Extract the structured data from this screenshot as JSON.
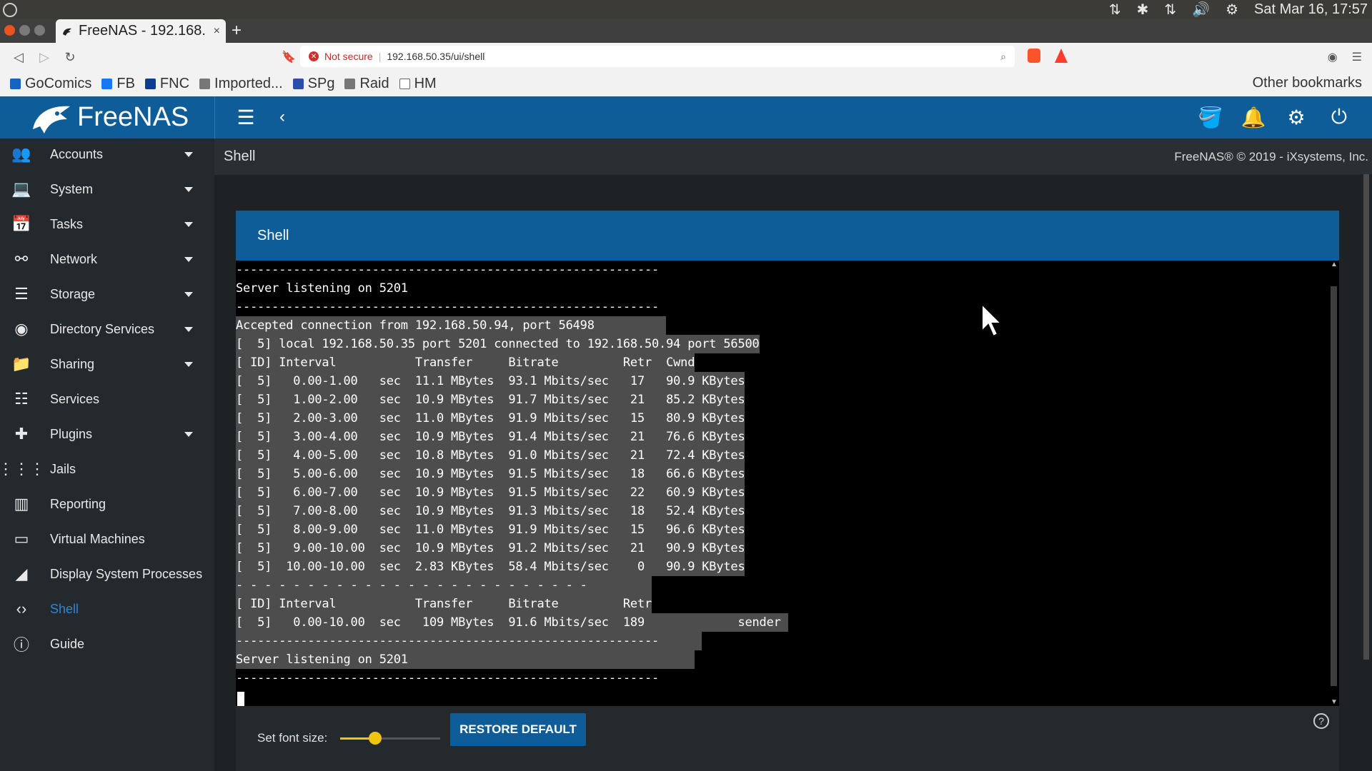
{
  "os": {
    "datetime": "Sat Mar 16, 17:57",
    "tray_icons": [
      "network-icon",
      "bluetooth-icon",
      "transfer-icon",
      "volume-icon",
      "settings-gear-icon"
    ]
  },
  "browser": {
    "tab_title": "FreeNAS - 192.168.",
    "tab_close": "×",
    "new_tab": "+",
    "security_label": "Not secure",
    "url": "192.168.50.35/ui/shell",
    "bookmarks": [
      {
        "label": "GoComics",
        "color": "#1565c0"
      },
      {
        "label": "FB",
        "color": "#1877f2"
      },
      {
        "label": "FNC",
        "color": "#0b3d91"
      },
      {
        "label": "Imported...",
        "color": "#777777"
      },
      {
        "label": "SPg",
        "color": "#2b4fa8"
      },
      {
        "label": "Raid",
        "color": "#777777"
      },
      {
        "label": "HM",
        "color": "#ffffff"
      }
    ],
    "other_bookmarks": "Other bookmarks"
  },
  "app": {
    "brand": "FreeNAS",
    "accent": "#0e5d98",
    "copyright": "FreeNAS® © 2019 - iXsystems, Inc.",
    "page_title": "Shell"
  },
  "sidebar": {
    "items": [
      {
        "label": "Accounts",
        "icon": "people-icon",
        "glyph": "👥",
        "caret": true
      },
      {
        "label": "System",
        "icon": "laptop-icon",
        "glyph": "💻",
        "caret": true
      },
      {
        "label": "Tasks",
        "icon": "calendar-icon",
        "glyph": "📅",
        "caret": true
      },
      {
        "label": "Network",
        "icon": "network-hub-icon",
        "glyph": "⚯",
        "caret": true
      },
      {
        "label": "Storage",
        "icon": "storage-icon",
        "glyph": "☰",
        "caret": true
      },
      {
        "label": "Directory Services",
        "icon": "directory-icon",
        "glyph": "◉",
        "caret": true
      },
      {
        "label": "Sharing",
        "icon": "folder-share-icon",
        "glyph": "📁",
        "caret": true
      },
      {
        "label": "Services",
        "icon": "sliders-icon",
        "glyph": "☷",
        "caret": false
      },
      {
        "label": "Plugins",
        "icon": "puzzle-icon",
        "glyph": "✚",
        "caret": true
      },
      {
        "label": "Jails",
        "icon": "grid-icon",
        "glyph": "⋮⋮⋮",
        "caret": false
      },
      {
        "label": "Reporting",
        "icon": "bar-chart-icon",
        "glyph": "▥",
        "caret": false
      },
      {
        "label": "Virtual Machines",
        "icon": "monitor-icon",
        "glyph": "▭",
        "caret": false
      },
      {
        "label": "Display System Processes",
        "icon": "processes-icon",
        "glyph": "◢",
        "caret": false
      },
      {
        "label": "Shell",
        "icon": "code-icon",
        "glyph": "‹›",
        "caret": false,
        "active": true
      },
      {
        "label": "Guide",
        "icon": "info-icon",
        "glyph": "ⓘ",
        "caret": false
      }
    ]
  },
  "shell": {
    "card_title": "Shell",
    "lines": [
      {
        "text": "-----------------------------------------------------------",
        "sel": false
      },
      {
        "text": "Server listening on 5201",
        "sel": false
      },
      {
        "text": "-----------------------------------------------------------",
        "sel": false
      },
      {
        "text": "Accepted connection from 192.168.50.94, port 56498          ",
        "sel": true
      },
      {
        "text": "[  5] local 192.168.50.35 port 5201 connected to 192.168.50.94 port 56500",
        "sel": true
      },
      {
        "text": "[ ID] Interval           Transfer     Bitrate         Retr  Cwnd",
        "sel": true
      },
      {
        "text": "[  5]   0.00-1.00   sec  11.1 MBytes  93.1 Mbits/sec   17   90.9 KBytes",
        "sel": true
      },
      {
        "text": "[  5]   1.00-2.00   sec  10.9 MBytes  91.7 Mbits/sec   21   85.2 KBytes",
        "sel": true
      },
      {
        "text": "[  5]   2.00-3.00   sec  11.0 MBytes  91.9 Mbits/sec   15   80.9 KBytes",
        "sel": true
      },
      {
        "text": "[  5]   3.00-4.00   sec  10.9 MBytes  91.4 Mbits/sec   21   76.6 KBytes",
        "sel": true
      },
      {
        "text": "[  5]   4.00-5.00   sec  10.8 MBytes  91.0 Mbits/sec   21   72.4 KBytes",
        "sel": true
      },
      {
        "text": "[  5]   5.00-6.00   sec  10.9 MBytes  91.5 Mbits/sec   18   66.6 KBytes",
        "sel": true
      },
      {
        "text": "[  5]   6.00-7.00   sec  10.9 MBytes  91.5 Mbits/sec   22   60.9 KBytes",
        "sel": true
      },
      {
        "text": "[  5]   7.00-8.00   sec  10.9 MBytes  91.3 Mbits/sec   18   52.4 KBytes",
        "sel": true
      },
      {
        "text": "[  5]   8.00-9.00   sec  11.0 MBytes  91.9 Mbits/sec   15   96.6 KBytes",
        "sel": true
      },
      {
        "text": "[  5]   9.00-10.00  sec  10.9 MBytes  91.2 Mbits/sec   21   90.9 KBytes",
        "sel": true
      },
      {
        "text": "[  5]  10.00-10.00  sec  2.83 KBytes  58.4 Mbits/sec    0   90.9 KBytes",
        "sel": true
      },
      {
        "text": "- - - - - - - - - - - - - - - - - - - - - - - - -         ",
        "sel": true
      },
      {
        "text": "[ ID] Interval           Transfer     Bitrate         Retr",
        "sel": true
      },
      {
        "text": "[  5]   0.00-10.00  sec   109 MBytes  91.6 Mbits/sec  189             sender ",
        "sel": true
      },
      {
        "text": "-----------------------------------------------------------      ",
        "sel": true
      },
      {
        "text": "Server listening on 5201                                        ",
        "sel": true
      },
      {
        "text": "-----------------------------------------------------------",
        "sel": false
      }
    ]
  },
  "footer": {
    "font_size_label": "Set font size:",
    "font_size_level_fraction": 0.35,
    "restore_label": "RESTORE DEFAULT",
    "help_glyph": "?"
  }
}
